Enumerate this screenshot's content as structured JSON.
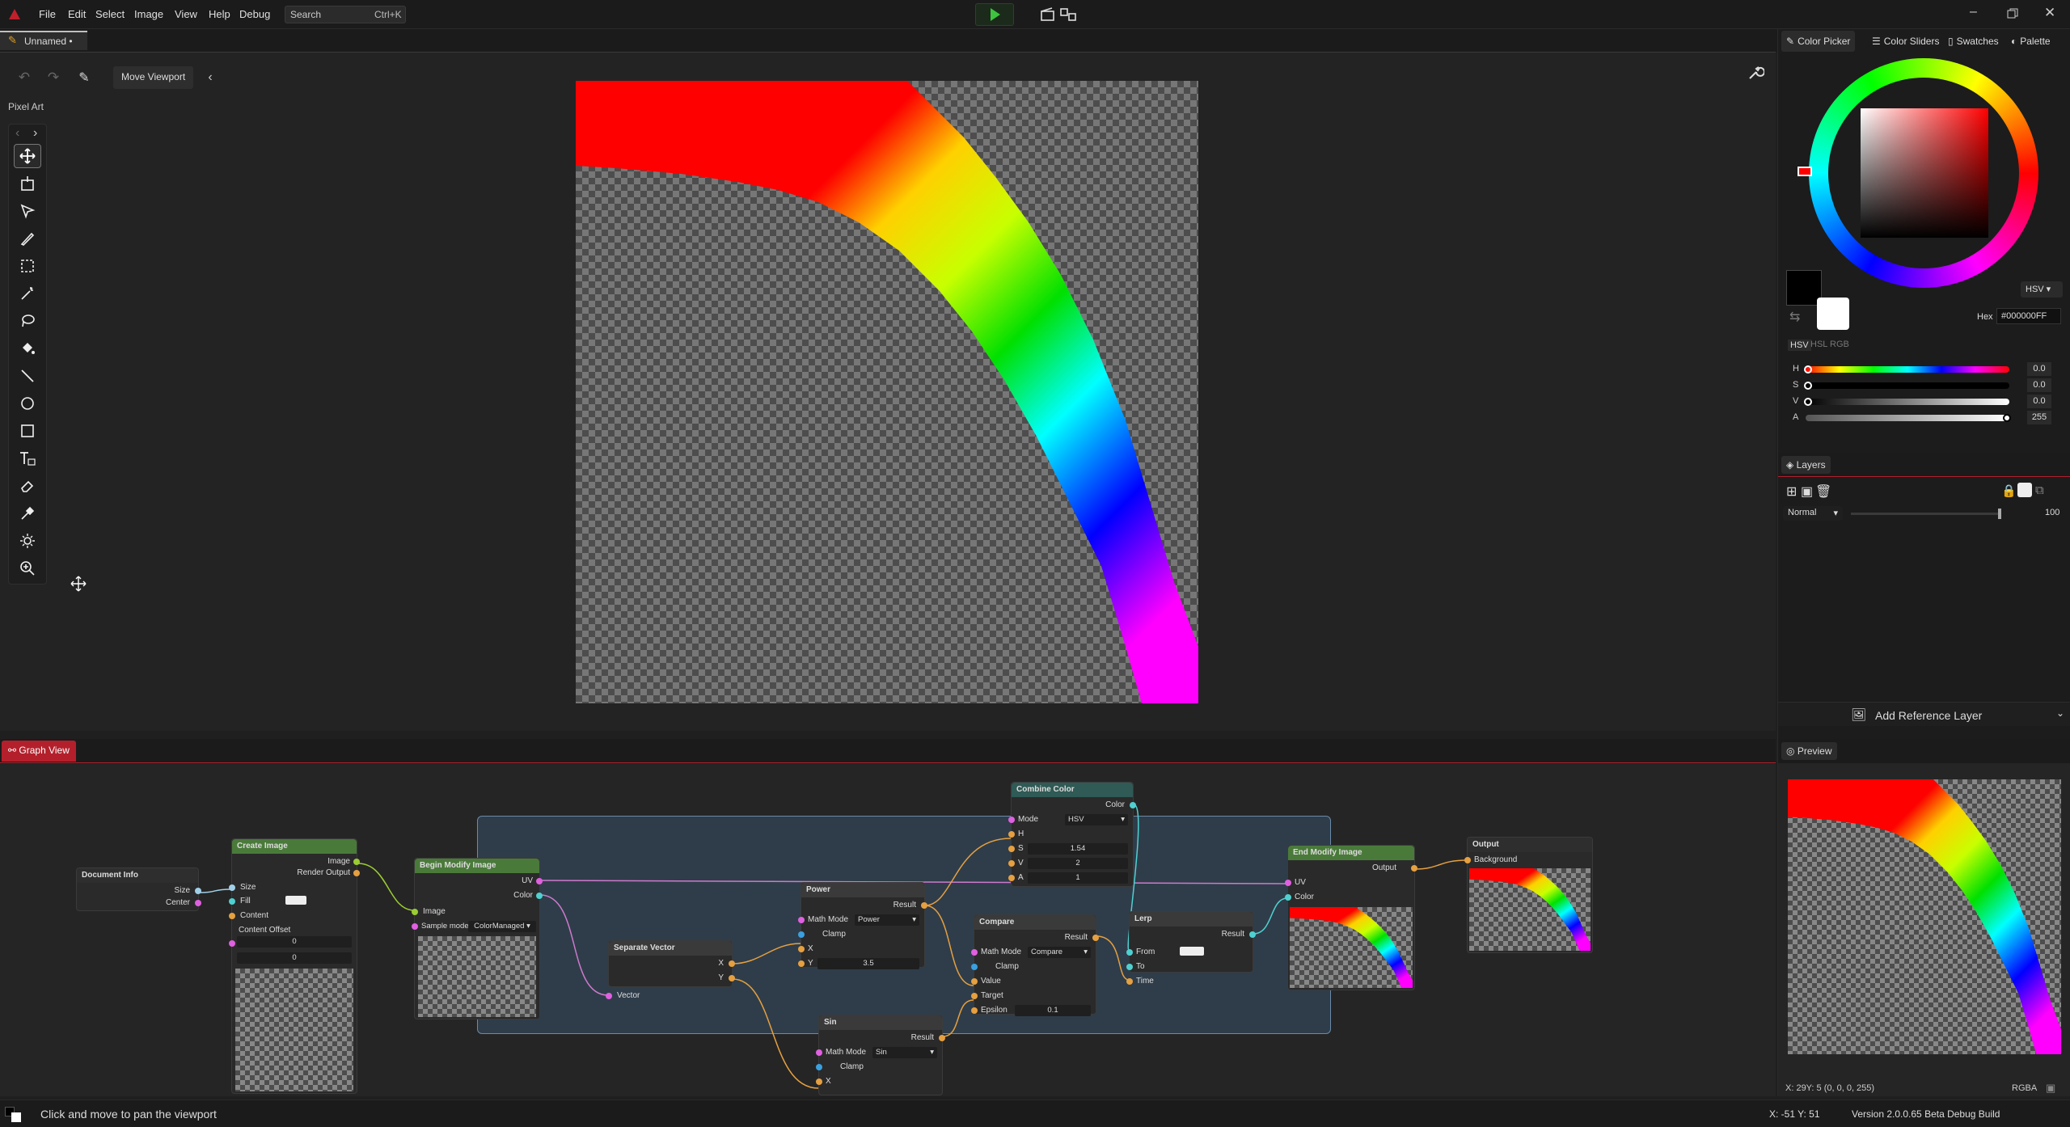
{
  "menu": [
    "File",
    "Edit",
    "Select",
    "Image",
    "View",
    "Help",
    "Debug"
  ],
  "search": {
    "label": "Search",
    "shortcut": "Ctrl+K"
  },
  "document_tab": "Unnamed •",
  "tool_options": {
    "move_viewport": "Move Viewport"
  },
  "toolset": "Pixel Art",
  "tools": [
    "move-icon",
    "crop-icon",
    "select-icon",
    "pen-icon",
    "rect-select-icon",
    "magic-wand-icon",
    "lasso-icon",
    "fill-icon",
    "line-icon",
    "ellipse-icon",
    "rectangle-icon",
    "text-icon",
    "eraser-icon",
    "color-picker-icon",
    "brightness-icon",
    "zoom-icon"
  ],
  "right_tabs": [
    "Color Picker",
    "Color Sliders",
    "Swatches",
    "Palette"
  ],
  "color": {
    "mode": "HSV",
    "hex_label": "Hex",
    "hex": "#000000FF",
    "modes": [
      "HSV",
      "HSL",
      "RGB"
    ],
    "sliders": [
      {
        "name": "H",
        "value": "0.0"
      },
      {
        "name": "S",
        "value": "0.0"
      },
      {
        "name": "V",
        "value": "0.0"
      },
      {
        "name": "A",
        "value": "255"
      }
    ],
    "primary": "#000000",
    "secondary": "#ffffff"
  },
  "layers": {
    "title": "Layers",
    "blend": "Normal",
    "opacity": "100",
    "add_reference": "Add Reference Layer"
  },
  "graph_tab": "Graph View",
  "preview_tab": "Preview",
  "nodes": {
    "doc_info": {
      "title": "Document Info",
      "size": "Size",
      "center": "Center"
    },
    "create_image": {
      "title": "Create Image",
      "image": "Image",
      "render_output": "Render Output",
      "size": "Size",
      "fill": "Fill",
      "content": "Content",
      "content_offset": "Content Offset",
      "off_x": "0",
      "off_y": "0"
    },
    "begin_modify": {
      "title": "Begin Modify Image",
      "uv": "UV",
      "color": "Color",
      "image": "Image",
      "sample_mode": "Sample mode",
      "sample_value": "ColorManaged"
    },
    "separate_vector": {
      "title": "Separate Vector",
      "x": "X",
      "y": "Y",
      "vector": "Vector"
    },
    "power": {
      "title": "Power",
      "result": "Result",
      "math_mode": "Math Mode",
      "mode_value": "Power",
      "clamp": "Clamp",
      "x": "X",
      "y": "Y",
      "y_value": "3.5"
    },
    "sin": {
      "title": "Sin",
      "result": "Result",
      "math_mode": "Math Mode",
      "mode_value": "Sin",
      "clamp": "Clamp",
      "x": "X"
    },
    "combine_color": {
      "title": "Combine Color",
      "color": "Color",
      "mode": "Mode",
      "mode_value": "HSV",
      "h": "H",
      "s": "S",
      "s_value": "1.54",
      "v": "V",
      "v_value": "2",
      "a": "A",
      "a_value": "1"
    },
    "compare": {
      "title": "Compare",
      "result": "Result",
      "math_mode": "Math Mode",
      "mode_value": "Compare",
      "clamp": "Clamp",
      "value": "Value",
      "target": "Target",
      "epsilon": "Epsilon",
      "eps_value": "0.1"
    },
    "lerp": {
      "title": "Lerp",
      "result": "Result",
      "from": "From",
      "to": "To",
      "time": "Time"
    },
    "end_modify": {
      "title": "End Modify Image",
      "output": "Output",
      "uv": "UV",
      "color": "Color"
    },
    "output": {
      "title": "Output",
      "background": "Background"
    }
  },
  "status": {
    "hint": "Click and move to pan the viewport",
    "pixel": "X: 29Y: 5   (0, 0, 0, 255)",
    "format": "RGBA",
    "coords": "X: -51 Y: 51",
    "version": "Version 2.0.0.65 Beta Debug Build"
  }
}
